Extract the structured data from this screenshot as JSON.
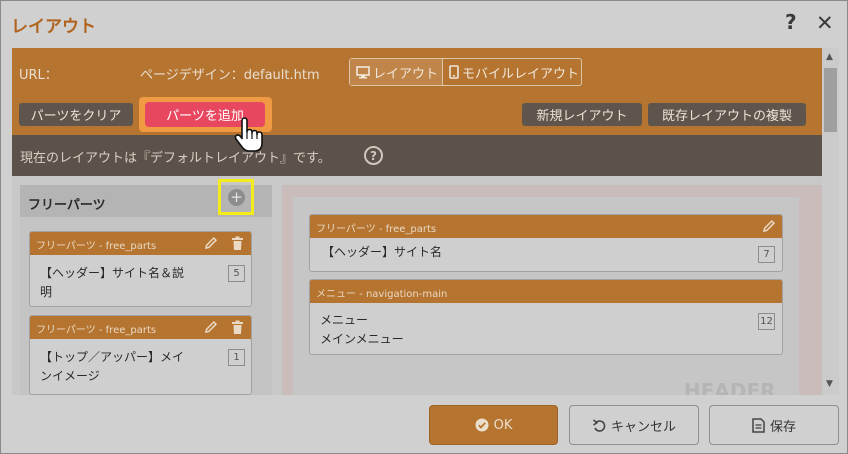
{
  "dialog": {
    "title": "レイアウト",
    "help_label": "?",
    "close_label": "✕"
  },
  "url_bar": {
    "url_label": "URL：",
    "page_design": "ページデザイン：default.htm",
    "tabs": [
      {
        "label": "レイアウト",
        "icon": "desktop-icon",
        "active": true
      },
      {
        "label": "モバイルレイアウト",
        "icon": "mobile-icon",
        "active": false
      }
    ]
  },
  "toolbar": {
    "clear_label": "パーツをクリア",
    "add_label": "パーツを追加",
    "new_layout_label": "新規レイアウト",
    "copy_layout_label": "既存レイアウトの複製"
  },
  "info": {
    "text": "現在のレイアウトは『デフォルトレイアウト』です。",
    "help_label": "?"
  },
  "free_parts": {
    "title": "フリーパーツ",
    "add_symbol": "+",
    "items": [
      {
        "type": "フリーパーツ - free_parts",
        "lines": [
          "【ヘッダー】サイト名＆説",
          "明"
        ],
        "count": "5"
      },
      {
        "type": "フリーパーツ - free_parts",
        "lines": [
          "【トップ／アッパー】メイ",
          "ンイメージ"
        ],
        "count": "1"
      }
    ]
  },
  "layout_zone": {
    "name": "HEADER",
    "items": [
      {
        "type": "フリーパーツ - free_parts",
        "lines": [
          "【ヘッダー】サイト名"
        ],
        "count": "7"
      },
      {
        "type": "メニュー - navigation-main",
        "lines": [
          "メニュー",
          "メインメニュー"
        ],
        "count": "12"
      }
    ]
  },
  "footer": {
    "ok_label": "OK",
    "cancel_label": "キャンセル",
    "save_label": "保存"
  },
  "colors": {
    "accent": "#b5742f",
    "highlight": "#e8485f",
    "annotation": "#f4ec1a"
  }
}
